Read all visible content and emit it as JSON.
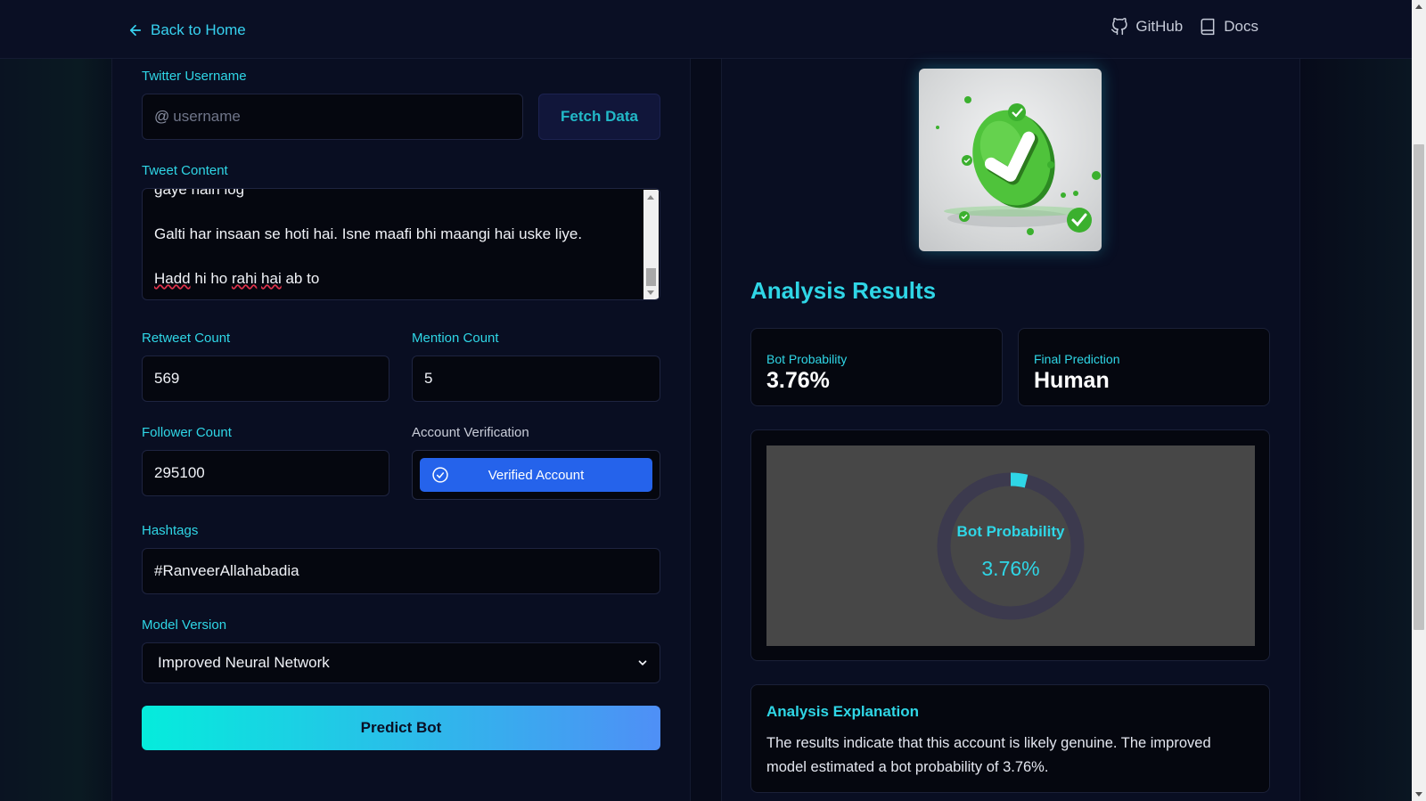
{
  "header": {
    "back_label": "Back to Home",
    "nav": [
      {
        "label": "GitHub",
        "icon": "github-icon"
      },
      {
        "label": "Docs",
        "icon": "book-icon"
      }
    ]
  },
  "form": {
    "username": {
      "label": "Twitter Username",
      "prefix": "@",
      "placeholder": "username",
      "value": ""
    },
    "fetch_label": "Fetch Data",
    "tweet": {
      "label": "Tweet Content",
      "lines": [
        "gaye hain log",
        "Galti har insaan se hoti hai. Isne maafi bhi maangi hai uske liye.",
        "Hadd hi ho rahi hai ab to"
      ]
    },
    "retweet": {
      "label": "Retweet Count",
      "value": "569"
    },
    "mention": {
      "label": "Mention Count",
      "value": "5"
    },
    "follower": {
      "label": "Follower Count",
      "value": "295100"
    },
    "verification": {
      "label": "Account Verification",
      "button": "Verified Account"
    },
    "hashtags": {
      "label": "Hashtags",
      "value": "#RanveerAllahabadia"
    },
    "model": {
      "label": "Model Version",
      "selected": "Improved Neural Network"
    },
    "predict_label": "Predict Bot"
  },
  "results": {
    "title": "Analysis Results",
    "bot_probability": {
      "label": "Bot Probability",
      "value": "3.76%"
    },
    "final_prediction": {
      "label": "Final Prediction",
      "value": "Human"
    },
    "chart": {
      "title": "Bot Probability",
      "value_text": "3.76%",
      "fraction": 0.0376
    },
    "explanation": {
      "title": "Analysis Explanation",
      "text": "The results indicate that this account is likely genuine. The improved model estimated a bot probability of 3.76%."
    }
  },
  "colors": {
    "accent": "#2fd6e6",
    "verify": "#2563eb",
    "gradient_start": "#05ecdc",
    "gradient_end": "#4f8ff6"
  }
}
